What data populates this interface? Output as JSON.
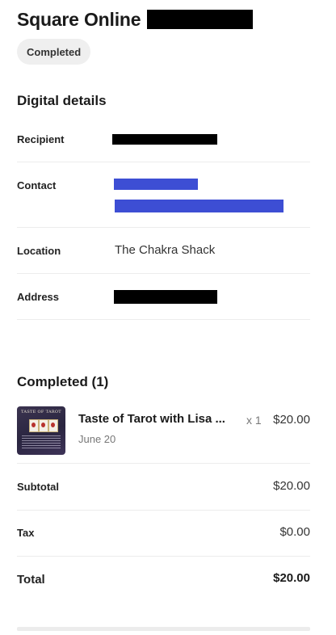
{
  "header": {
    "title": "Square Online"
  },
  "status_badge": "Completed",
  "digital_details": {
    "title": "Digital details",
    "rows": {
      "recipient": {
        "label": "Recipient"
      },
      "contact": {
        "label": "Contact"
      },
      "location": {
        "label": "Location",
        "value": "The Chakra Shack"
      },
      "address": {
        "label": "Address"
      }
    }
  },
  "completed": {
    "title": "Completed (1)",
    "item": {
      "image_title": "TASTE OF TAROT",
      "name": "Taste of Tarot with Lisa ...",
      "date": "June 20",
      "quantity": "x 1",
      "price": "$20.00"
    }
  },
  "summary": {
    "subtotal": {
      "label": "Subtotal",
      "value": "$20.00"
    },
    "tax": {
      "label": "Tax",
      "value": "$0.00"
    },
    "total": {
      "label": "Total",
      "value": "$20.00"
    }
  },
  "colors": {
    "redaction": "#000000",
    "link_highlight": "#3d4ed4",
    "badge_bg": "#efefef",
    "divider": "#ececec"
  }
}
